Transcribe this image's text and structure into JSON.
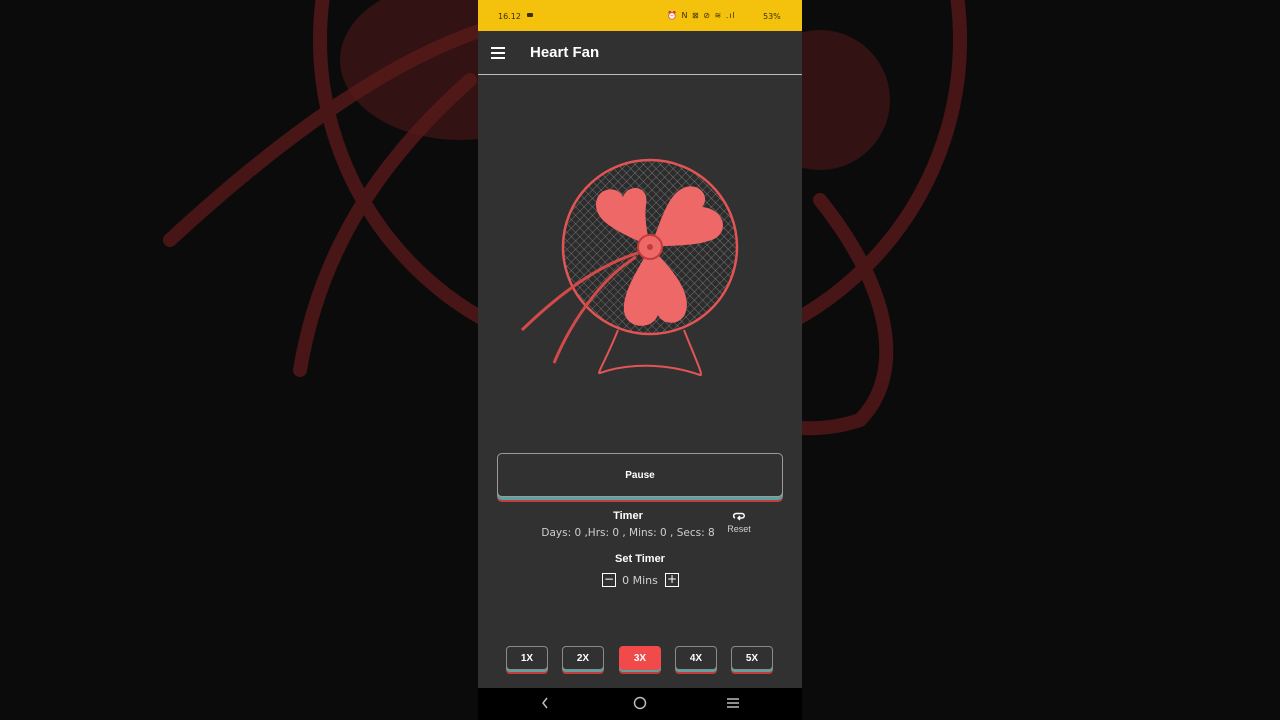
{
  "status_bar": {
    "time": "16.12",
    "icons": "⏰ N ⊠ ⊘ ≋ .ıl",
    "battery": "53%"
  },
  "app_bar": {
    "title": "Heart Fan"
  },
  "controls": {
    "pause_label": "Pause"
  },
  "timer": {
    "title": "Timer",
    "value": "Days: 0 ,Hrs: 0 , Mins: 0 , Secs: 8",
    "reset_label": "Reset"
  },
  "set_timer": {
    "title": "Set Timer",
    "minus": "−",
    "plus": "+",
    "value": "0 Mins"
  },
  "speed": {
    "options": [
      "1X",
      "2X",
      "3X",
      "4X",
      "5X"
    ],
    "selected": "3X"
  },
  "colors": {
    "accent": "#f04a4a",
    "status_bar": "#f4c20d",
    "background": "#313131"
  },
  "icons": {
    "menu": "hamburger-menu-icon",
    "reset": "reset-loop-icon",
    "nav_back": "back-chevron-icon",
    "nav_home": "home-circle-icon",
    "nav_recents": "recents-lines-icon"
  }
}
